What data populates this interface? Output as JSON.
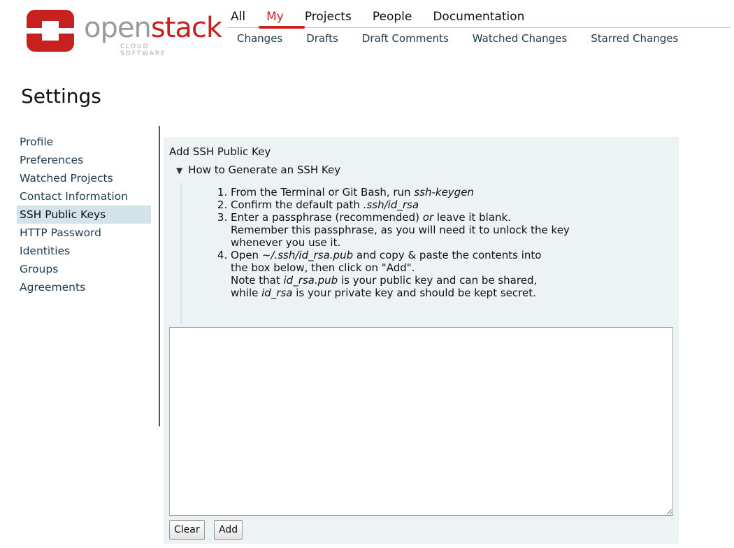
{
  "header": {
    "logo": {
      "word_part1": "open",
      "word_part2": "stack",
      "subtitle": "CLOUD SOFTWARE"
    },
    "top_menu": [
      {
        "label": "All",
        "active": false
      },
      {
        "label": "My",
        "active": true
      },
      {
        "label": "Projects",
        "active": false
      },
      {
        "label": "People",
        "active": false
      },
      {
        "label": "Documentation",
        "active": false
      }
    ],
    "sub_menu": [
      "Changes",
      "Drafts",
      "Draft Comments",
      "Watched Changes",
      "Starred Changes"
    ]
  },
  "page": {
    "title": "Settings"
  },
  "sidebar": {
    "items": [
      {
        "label": "Profile",
        "selected": false
      },
      {
        "label": "Preferences",
        "selected": false
      },
      {
        "label": "Watched Projects",
        "selected": false
      },
      {
        "label": "Contact Information",
        "selected": false
      },
      {
        "label": "SSH Public Keys",
        "selected": true
      },
      {
        "label": "HTTP Password",
        "selected": false
      },
      {
        "label": "Identities",
        "selected": false
      },
      {
        "label": "Groups",
        "selected": false
      },
      {
        "label": "Agreements",
        "selected": false
      }
    ]
  },
  "ssh_panel": {
    "title": "Add SSH Public Key",
    "howto_toggle": "How to Generate an SSH Key",
    "steps": {
      "s1_text": "From the Terminal or Git Bash, run ",
      "s1_cmd": "ssh-keygen",
      "s2_text": "Confirm the default path ",
      "s2_path": ".ssh/id_rsa",
      "s3_a": "Enter a passphrase (recommended) ",
      "s3_or": "or",
      "s3_b": " leave it blank.",
      "s3_c": "Remember this passphrase, as you will need it to unlock the key whenever you use it.",
      "s4_a": "Open ",
      "s4_path": "~/.ssh/id_rsa.pub",
      "s4_b": " and copy & paste the contents into",
      "s4_c": "the box below, then click on \"Add\".",
      "s4_note_a": "Note that ",
      "s4_pub": "id_rsa.pub",
      "s4_note_b": " is your public key and can be shared,",
      "s4_note_c": "while ",
      "s4_priv": "id_rsa",
      "s4_note_d": " is your private key and should be kept secret."
    },
    "key_value": "",
    "clear_label": "Clear",
    "add_label": "Add"
  },
  "colors": {
    "accent_red": "#c8201e",
    "link_dark": "#1d3a4d",
    "selected_bg": "#d3e3ea",
    "panel_bg": "#edf2f4"
  },
  "icons": {
    "logo": "openstack-logo-icon",
    "toggle": "triangle-down-icon"
  }
}
